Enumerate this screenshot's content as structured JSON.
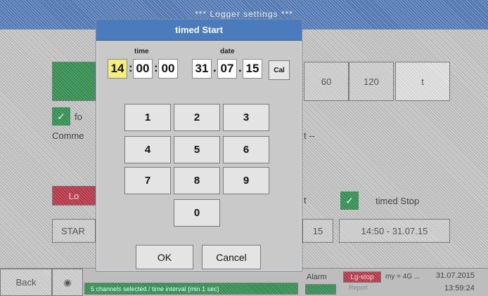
{
  "background": {
    "title": "*** Logger settings ***",
    "interval_buttons": [
      "60",
      "120",
      "t"
    ],
    "checkbox_for_label": "fo",
    "comment_label": "Comme",
    "comment_value_fragment": "t --",
    "log_button": "Lo",
    "start_label": "STAR",
    "timed_stop_label": "timed Stop",
    "stop_time_fragment": "15",
    "stop_datetime": "14:50 - 31.07.15"
  },
  "status_bar": {
    "back": "Back",
    "status_text": "5 channels selected / time interval (min 1 sec)",
    "alarm": "Alarm",
    "lg_stop": "Lg-stop",
    "report": "Report",
    "memory": "my = 4G ...",
    "date": "31.07.2015",
    "time": "13:59:24"
  },
  "dialog": {
    "title": "timed Start",
    "time_label": "time",
    "date_label": "date",
    "time": {
      "hour": "14",
      "minute": "00",
      "second": "00"
    },
    "date": {
      "day": "31",
      "month": "07",
      "year": "15"
    },
    "time_sep": ":",
    "date_sep": ".",
    "cal_label": "Cal",
    "keys": [
      "1",
      "2",
      "3",
      "4",
      "5",
      "6",
      "7",
      "8",
      "9",
      "0"
    ],
    "ok_label": "OK",
    "cancel_label": "Cancel"
  },
  "colors": {
    "title_blue": "#4a7bbd",
    "active_field": "#f4ef7c",
    "green": "#2f8a4d",
    "red": "#b23142"
  }
}
